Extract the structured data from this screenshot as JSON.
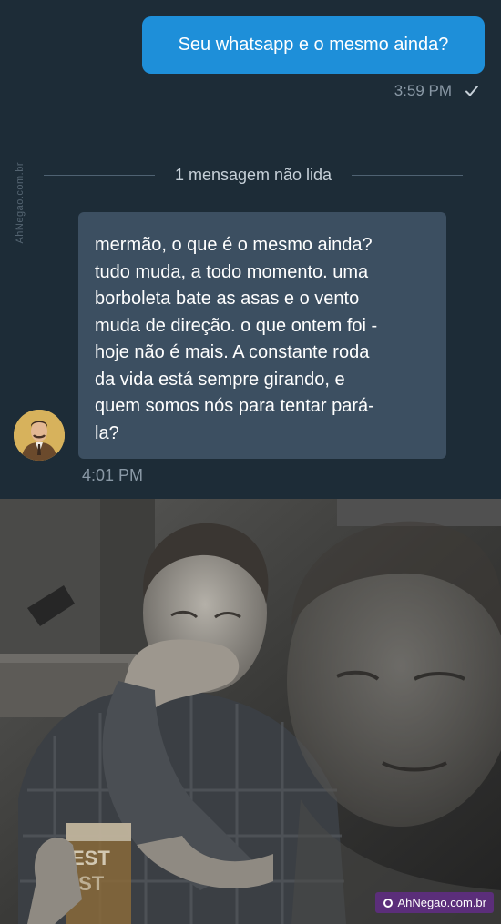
{
  "chat": {
    "outgoing": {
      "text": "Seu whatsapp e o mesmo ainda?",
      "time": "3:59 PM"
    },
    "unread_divider": "1 mensagem não lida",
    "incoming": {
      "lines": [
        "mermão, o que é o mesmo ainda?",
        "tudo muda, a todo momento. uma",
        "borboleta bate as asas e o vento",
        "muda de direção. o que ontem foi -",
        "hoje não é mais. A constante roda",
        "da vida está sempre girando, e",
        "quem somos nós para tentar pará-",
        "la?"
      ],
      "time": "4:01 PM"
    },
    "side_watermark": "AhNegao.com.br"
  },
  "meme": {
    "brand_label": "AhNegao.com.br",
    "glass_text": [
      "EST",
      "IST"
    ]
  },
  "colors": {
    "chat_background": "#1d2c37",
    "outgoing_bubble": "#1e8fd9",
    "incoming_bubble": "#3c4f61",
    "brand_badge": "#5b2e7a"
  }
}
